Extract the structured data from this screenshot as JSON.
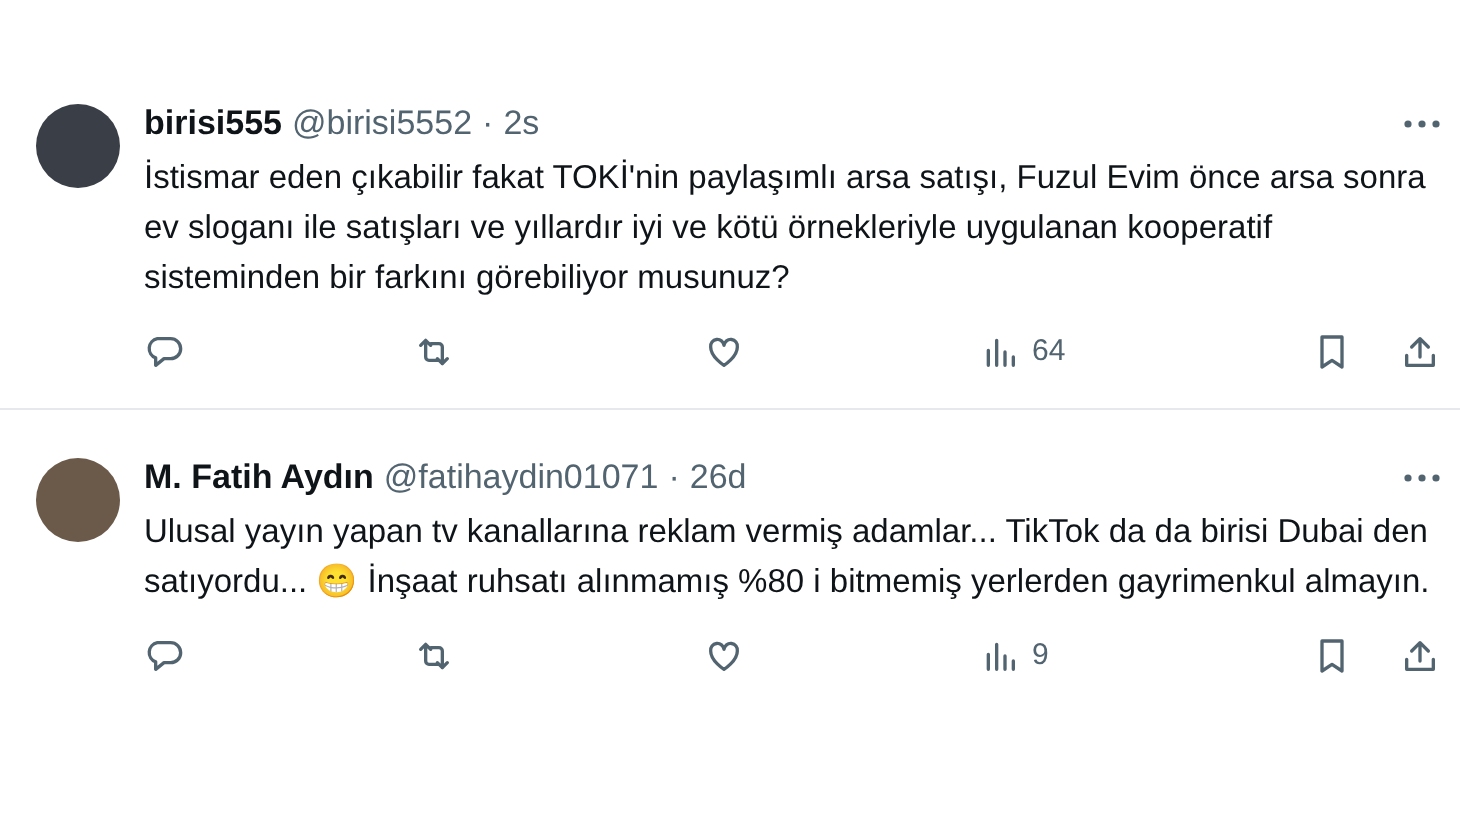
{
  "tweets": [
    {
      "name": "birisi555",
      "handle": "@birisi5552",
      "separator": "·",
      "time": "2s",
      "text": "İstismar eden çıkabilir fakat TOKİ'nin paylaşımlı arsa satışı, Fuzul Evim önce arsa sonra ev sloganı ile satışları ve yıllardır iyi ve kötü örnekleriyle uygulanan kooperatif sisteminden bir farkını görebiliyor musunuz?",
      "views": "64"
    },
    {
      "name": "M. Fatih Aydın",
      "handle": "@fatihaydin01071",
      "separator": "·",
      "time": "26d",
      "text": "Ulusal yayın yapan tv kanallarına reklam vermiş adamlar... TikTok da da birisi Dubai den satıyordu... 😁 İnşaat ruhsatı alınmamış %80 i bitmemiş yerlerden gayrimenkul almayın.",
      "views": "9"
    }
  ]
}
